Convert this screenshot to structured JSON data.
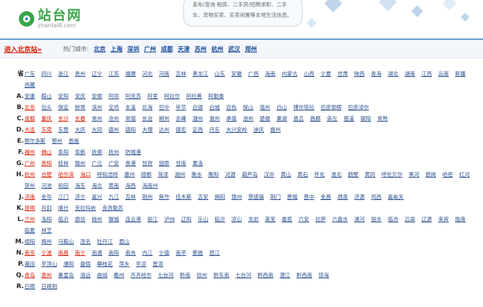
{
  "site": {
    "name": "站台网",
    "domain": "zhantai8.com"
  },
  "bubble_text": "发布/查询 租房、二手房/招聘求职、二手车、宠物买卖、买卖闲置等本地生活信息。",
  "bar": {
    "enter_link": "进入北京站»",
    "hot_label": "热门城市:",
    "hot_cities": [
      "北京",
      "上海",
      "深圳",
      "广州",
      "成都",
      "天津",
      "苏州",
      "杭州",
      "武汉",
      "郑州"
    ]
  },
  "groups": [
    {
      "letter": "省",
      "cities": [
        "广东",
        "四川",
        "浙江",
        "贵州",
        "辽宁",
        "江苏",
        "福建",
        "河北",
        "河南",
        "吉林",
        "黑龙江",
        "山东",
        "安徽",
        "广西",
        "海南",
        "内蒙古",
        "山西",
        "宁夏",
        "甘肃",
        "陕西",
        "青海",
        "湖北",
        "湖南",
        "江西",
        "云南",
        "新疆",
        "西藏"
      ]
    },
    {
      "letter": "A.",
      "cities": [
        "安康",
        "鞍山",
        "安阳",
        "安庆",
        "安顺",
        "阿坝",
        "阿克苏",
        "阿里",
        "阿拉尔",
        "阿拉善",
        "阿勒泰"
      ]
    },
    {
      "letter": "B.",
      "cities": [
        "北京",
        "包头",
        "保定",
        "蚌埠",
        "滨州",
        "宝鸡",
        "本溪",
        "北海",
        "巴中",
        "毕节",
        "白银",
        "白城",
        "百色",
        "保山",
        "亳州",
        "白山",
        "博尔塔拉",
        "巴彦郭楞",
        "巴彦淖尔"
      ]
    },
    {
      "letter": "C.",
      "cities": [
        "成都",
        "重庆",
        "长沙",
        "长春",
        "常州",
        "沧州",
        "常德",
        "长治",
        "郴州",
        "赤峰",
        "潮州",
        "滁州",
        "承德",
        "池州",
        "楚雄",
        "巢湖",
        "昌吉",
        "昌都",
        "崇左",
        "慈溪",
        "朝阳",
        "常熟"
      ]
    },
    {
      "letter": "D.",
      "cities": [
        "大连",
        "东莞",
        "东营",
        "大庆",
        "大同",
        "德州",
        "德阳",
        "大理",
        "达州",
        "德宏",
        "定西",
        "丹东",
        "大兴安岭",
        "迪庆",
        "儋州"
      ]
    },
    {
      "letter": "E.",
      "cities": [
        "鄂尔多斯",
        "鄂州",
        "恩施"
      ]
    },
    {
      "letter": "F.",
      "cities": [
        "福州",
        "佛山",
        "阜阳",
        "阜新",
        "抚顺",
        "抚州",
        "防城港"
      ]
    },
    {
      "letter": "G.",
      "cities": [
        "广州",
        "贵阳",
        "桂林",
        "赣州",
        "广元",
        "广安",
        "贵港",
        "甘孜",
        "固原",
        "甘南",
        "果洛"
      ]
    },
    {
      "letter": "H.",
      "cities": [
        "杭州",
        "合肥",
        "哈尔滨",
        "海口",
        "呼和浩特",
        "惠州",
        "邯郸",
        "菏泽",
        "湖州",
        "衡水",
        "衡阳",
        "河源",
        "葫芦岛",
        "汉中",
        "黄山",
        "黄石",
        "怀化",
        "淮北",
        "鹤壁",
        "黄冈",
        "呼伦贝尔",
        "黑河",
        "鹤岗",
        "哈密",
        "红河",
        "贺州",
        "河池",
        "和田",
        "海东",
        "海北",
        "黄南",
        "海西",
        "海南州"
      ]
    },
    {
      "letter": "J.",
      "cities": [
        "济南",
        "金华",
        "江门",
        "济宁",
        "嘉兴",
        "九江",
        "吉林",
        "荆州",
        "焦作",
        "佳木斯",
        "吉安",
        "揭阳",
        "锦州",
        "景德镇",
        "荆门",
        "晋城",
        "晋中",
        "金昌",
        "酒泉",
        "济源",
        "鸡西",
        "嘉峪关"
      ]
    },
    {
      "letter": "K.",
      "cities": [
        "昆明",
        "开封",
        "喀什",
        "克拉玛依",
        "克孜勒苏"
      ]
    },
    {
      "letter": "L.",
      "cities": [
        "兰州",
        "洛阳",
        "临沂",
        "廊坊",
        "柳州",
        "聊城",
        "连云港",
        "丽江",
        "泸州",
        "辽阳",
        "乐山",
        "临汾",
        "凉山",
        "龙岩",
        "莱芜",
        "娄底",
        "六安",
        "拉萨",
        "六盘水",
        "漯河",
        "丽水",
        "临沧",
        "吕梁",
        "辽源",
        "来宾",
        "陇南",
        "临夏",
        "林芝"
      ]
    },
    {
      "letter": "M.",
      "cities": [
        "绵阳",
        "梅州",
        "马鞍山",
        "茂名",
        "牡丹江",
        "眉山"
      ]
    },
    {
      "letter": "N.",
      "cities": [
        "南京",
        "宁波",
        "南昌",
        "南宁",
        "南通",
        "南阳",
        "南充",
        "内江",
        "宁德",
        "南平",
        "那曲",
        "怒江"
      ]
    },
    {
      "letter": "P.",
      "cities": [
        "莆田",
        "平顶山",
        "濮阳",
        "盘锦",
        "攀枝花",
        "萍乡",
        "平凉",
        "普洱"
      ]
    },
    {
      "letter": "Q.",
      "cities": [
        "青岛",
        "泉州",
        "秦皇岛",
        "清远",
        "曲靖",
        "衢州",
        "齐齐哈尔",
        "七台河",
        "黔南",
        "钦州",
        "黔东南",
        "七台河",
        "黔西南",
        "潜江",
        "黔西南",
        "琼海"
      ]
    },
    {
      "letter": "R.",
      "cities": [
        "日照",
        "日喀则"
      ]
    }
  ],
  "red_cities": [
    "北京",
    "成都",
    "重庆",
    "长沙",
    "长春",
    "大连",
    "东莞",
    "福州",
    "佛山",
    "广州",
    "贵阳",
    "杭州",
    "合肥",
    "哈尔滨",
    "海口",
    "济南",
    "昆明",
    "兰州",
    "南京",
    "宁波",
    "南昌",
    "南宁",
    "青岛",
    "泉州"
  ]
}
